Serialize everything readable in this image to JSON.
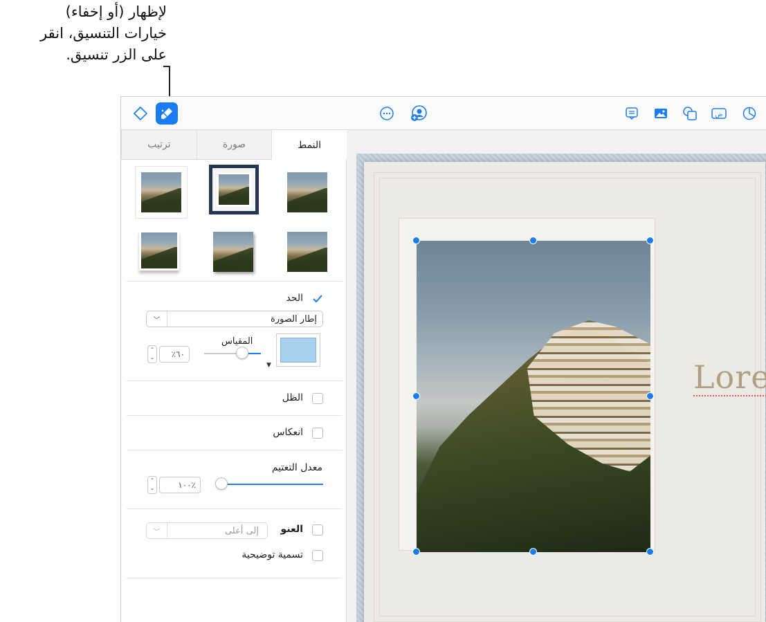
{
  "callout": {
    "line1": "لإظهار (أو إخفاء)",
    "line2": "خيارات التنسيق، انقر",
    "line3": "على الزر تنسيق."
  },
  "toolbar": {
    "icons": [
      "navigator-icon",
      "format-brush-icon",
      "more-icon",
      "collaborate-icon",
      "comment-icon",
      "media-icon",
      "shape-icon",
      "textbox-icon",
      "chart-icon"
    ]
  },
  "sidebar": {
    "tabs": [
      {
        "label": "النمط",
        "active": true
      },
      {
        "label": "صورة",
        "active": false
      },
      {
        "label": "ترتيب",
        "active": false
      }
    ],
    "border": {
      "label": "الحد",
      "checked": true,
      "style_value": "إطار الصورة",
      "scale_label": "المقياس",
      "scale_value": "٦٠٪"
    },
    "shadow": {
      "label": "الظل",
      "checked": false
    },
    "reflection": {
      "label": "انعكاس",
      "checked": false
    },
    "opacity": {
      "label": "معدل التعتيم",
      "value": "٪١٠٠"
    },
    "title": {
      "label": "العنو",
      "position_value": "إلى أعلى",
      "checked": false
    },
    "caption": {
      "label": "تسمية توضيحية",
      "checked": false
    }
  },
  "canvas": {
    "text": "Lore"
  },
  "colors": {
    "accent": "#1a7cf0",
    "swatch": "#a7cfee"
  }
}
